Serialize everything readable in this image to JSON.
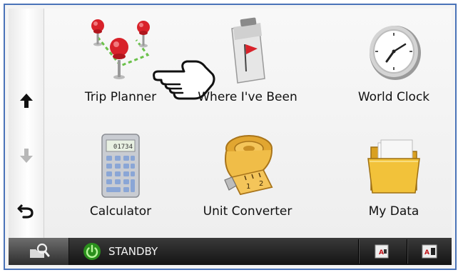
{
  "sidebar": {
    "up_label": "scroll-up",
    "down_label": "scroll-down",
    "back_label": "back"
  },
  "apps": [
    {
      "label": "Trip Planner",
      "icon": "map-pins-icon"
    },
    {
      "label": "Where I've Been",
      "icon": "flag-notepad-icon"
    },
    {
      "label": "World Clock",
      "icon": "clock-icon"
    },
    {
      "label": "Calculator",
      "icon": "calculator-icon"
    },
    {
      "label": "Unit Converter",
      "icon": "tape-measure-icon"
    },
    {
      "label": "My Data",
      "icon": "folder-icon"
    }
  ],
  "calculator_display": "01734",
  "bottombar": {
    "standby_label": "STANDBY"
  },
  "colors": {
    "frame_border": "#4a73b8",
    "pin_red": "#d8222a",
    "standby_green": "#3fbf2a",
    "folder_yellow": "#f2c23a"
  }
}
